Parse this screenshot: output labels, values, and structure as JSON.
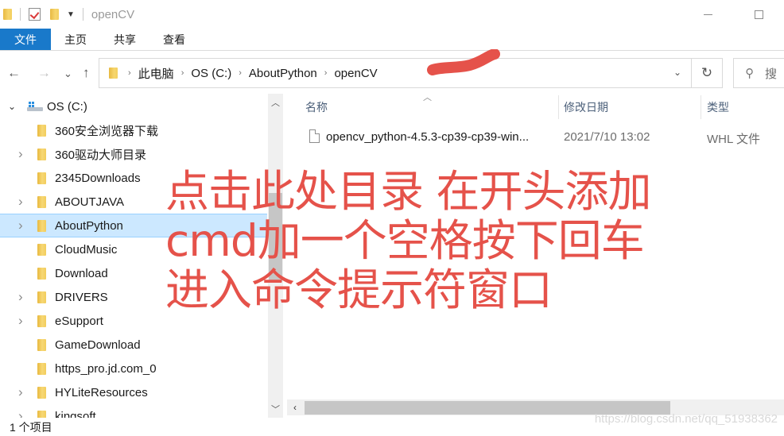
{
  "window": {
    "title": "openCV",
    "quick_access": {
      "folder_icon": "folder-icon",
      "properties_icon": "checkmark-properties-icon",
      "new_folder_icon": "new-folder-icon",
      "dropdown_icon": "dropdown-icon"
    }
  },
  "ribbon": {
    "tabs": [
      {
        "label": "文件",
        "active": true
      },
      {
        "label": "主页"
      },
      {
        "label": "共享"
      },
      {
        "label": "查看"
      }
    ]
  },
  "navigation": {
    "back": "←",
    "forward": "→",
    "recent": "⌄",
    "up": "↑",
    "breadcrumb": [
      "此电脑",
      "OS (C:)",
      "AboutPython",
      "openCV"
    ],
    "crumb_separator": "›",
    "address_dropdown": "⌄",
    "refresh": "↻",
    "search_placeholder": "搜"
  },
  "tree": {
    "drive": {
      "label": "OS (C:)",
      "expanded": true
    },
    "items": [
      {
        "label": "360安全浏览器下载",
        "has_children": false
      },
      {
        "label": "360驱动大师目录",
        "has_children": true
      },
      {
        "label": "2345Downloads",
        "has_children": false
      },
      {
        "label": "ABOUTJAVA",
        "has_children": true
      },
      {
        "label": "AboutPython",
        "has_children": true,
        "selected": true
      },
      {
        "label": "CloudMusic",
        "has_children": false
      },
      {
        "label": "Download",
        "has_children": false
      },
      {
        "label": "DRIVERS",
        "has_children": true
      },
      {
        "label": "eSupport",
        "has_children": true
      },
      {
        "label": "GameDownload",
        "has_children": false
      },
      {
        "label": "https_pro.jd.com_0",
        "has_children": false
      },
      {
        "label": "HYLiteResources",
        "has_children": true
      },
      {
        "label": "kingsoft",
        "has_children": true
      }
    ]
  },
  "file_list": {
    "columns": [
      "名称",
      "修改日期",
      "类型"
    ],
    "sorted_by": "名称",
    "rows": [
      {
        "name": "opencv_python-4.5.3-cp39-cp39-win...",
        "modified": "2021/7/10 13:02",
        "type": "WHL 文件"
      }
    ]
  },
  "status": {
    "item_count": "1 个项目"
  },
  "annotation": {
    "lines": [
      "点击此处目录  在开头添加",
      "cmd加一个空格按下回车",
      "进入命令提示符窗口"
    ],
    "color": "#e5524a"
  },
  "watermark": "https://blog.csdn.net/qq_51938362"
}
